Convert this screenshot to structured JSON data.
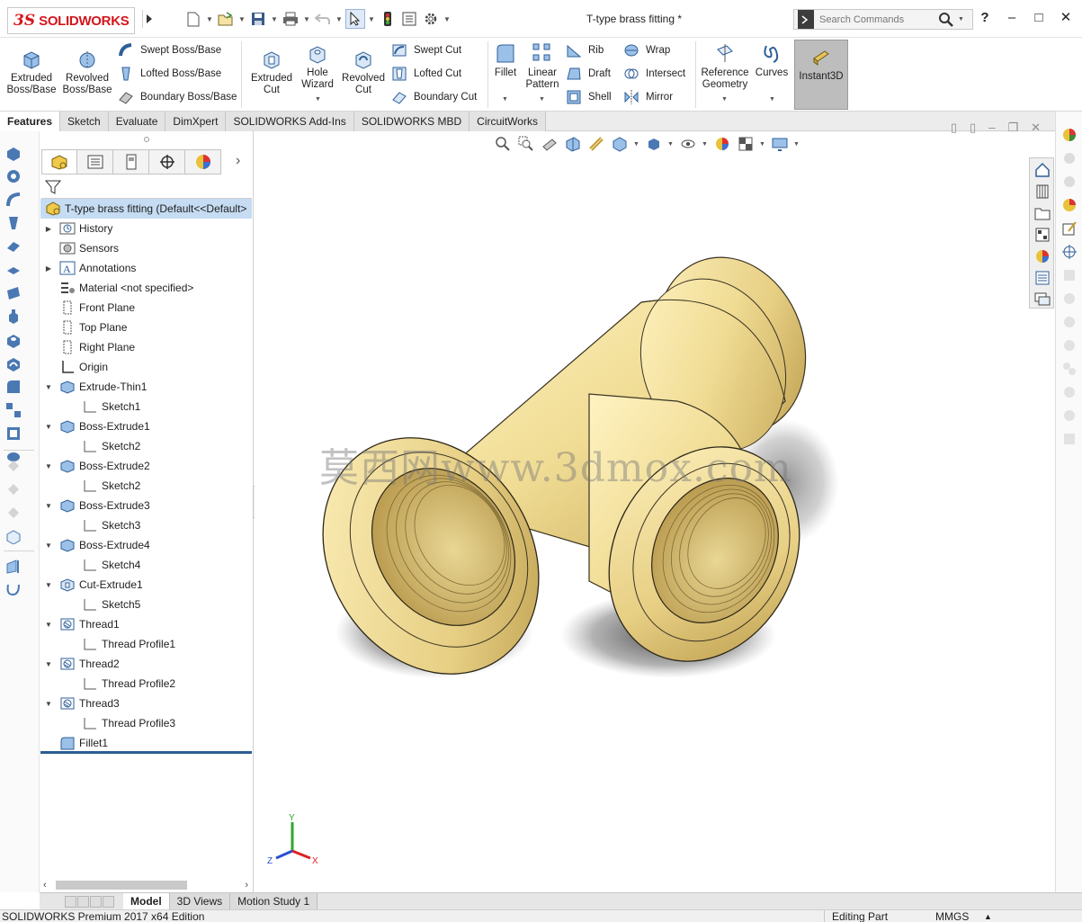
{
  "app": {
    "logo_text": "SOLIDWORKS",
    "document_title": "T-type brass fitting *"
  },
  "search": {
    "placeholder": "Search Commands"
  },
  "window_controls": {
    "help": "?",
    "minimize": "–",
    "maximize": "□",
    "close": "✕"
  },
  "ribbon": {
    "extruded_boss": "Extruded Boss/Base",
    "revolved_boss": "Revolved Boss/Base",
    "swept_boss": "Swept Boss/Base",
    "lofted_boss": "Lofted Boss/Base",
    "boundary_boss": "Boundary Boss/Base",
    "extruded_cut": "Extruded Cut",
    "hole_wizard": "Hole Wizard",
    "revolved_cut": "Revolved Cut",
    "swept_cut": "Swept Cut",
    "lofted_cut": "Lofted Cut",
    "boundary_cut": "Boundary Cut",
    "fillet": "Fillet",
    "linear_pattern": "Linear Pattern",
    "rib": "Rib",
    "draft": "Draft",
    "shell": "Shell",
    "wrap": "Wrap",
    "intersect": "Intersect",
    "mirror": "Mirror",
    "reference_geometry": "Reference Geometry",
    "curves": "Curves",
    "instant3d": "Instant3D"
  },
  "tabs": [
    "Features",
    "Sketch",
    "Evaluate",
    "DimXpert",
    "SOLIDWORKS Add-Ins",
    "SOLIDWORKS MBD",
    "CircuitWorks"
  ],
  "tree": {
    "root": "T-type brass fitting  (Default<<Default>",
    "items": [
      {
        "label": "History",
        "icon": "history-icon"
      },
      {
        "label": "Sensors",
        "icon": "sensor-icon"
      },
      {
        "label": "Annotations",
        "icon": "annotations-icon"
      },
      {
        "label": "Material <not specified>",
        "icon": "material-icon"
      },
      {
        "label": "Front Plane",
        "icon": "plane-icon"
      },
      {
        "label": "Top Plane",
        "icon": "plane-icon"
      },
      {
        "label": "Right Plane",
        "icon": "plane-icon"
      },
      {
        "label": "Origin",
        "icon": "origin-icon"
      },
      {
        "label": "Extrude-Thin1",
        "icon": "extrude-icon"
      },
      {
        "label": "Sketch1",
        "icon": "sketch-icon"
      },
      {
        "label": "Boss-Extrude1",
        "icon": "extrude-icon"
      },
      {
        "label": "Sketch2",
        "icon": "sketch-icon"
      },
      {
        "label": "Boss-Extrude2",
        "icon": "extrude-icon"
      },
      {
        "label": "Sketch2",
        "icon": "sketch-icon"
      },
      {
        "label": "Boss-Extrude3",
        "icon": "extrude-icon"
      },
      {
        "label": "Sketch3",
        "icon": "sketch-icon"
      },
      {
        "label": "Boss-Extrude4",
        "icon": "extrude-icon"
      },
      {
        "label": "Sketch4",
        "icon": "sketch-icon"
      },
      {
        "label": "Cut-Extrude1",
        "icon": "cut-extrude-icon"
      },
      {
        "label": "Sketch5",
        "icon": "sketch-icon"
      },
      {
        "label": "Thread1",
        "icon": "thread-icon"
      },
      {
        "label": "Thread Profile1",
        "icon": "sketch-icon"
      },
      {
        "label": "Thread2",
        "icon": "thread-icon"
      },
      {
        "label": "Thread Profile2",
        "icon": "sketch-icon"
      },
      {
        "label": "Thread3",
        "icon": "thread-icon"
      },
      {
        "label": "Thread Profile3",
        "icon": "sketch-icon"
      },
      {
        "label": "Fillet1",
        "icon": "fillet-icon"
      }
    ]
  },
  "watermark": "莫西网www.3dmox.com",
  "triad": {
    "x": "X",
    "y": "Y",
    "z": "Z"
  },
  "bottom_tabs": [
    "Model",
    "3D Views",
    "Motion Study 1"
  ],
  "status": {
    "edition": "SOLIDWORKS Premium 2017 x64 Edition",
    "mode": "Editing Part",
    "units": "MMGS"
  },
  "colors": {
    "brass_light": "#fdf0b6",
    "brass_mid": "#e9d38a",
    "brass_dark": "#b89a4c",
    "selection_blue": "#c5dcf2",
    "logo_red": "#d4161c"
  }
}
